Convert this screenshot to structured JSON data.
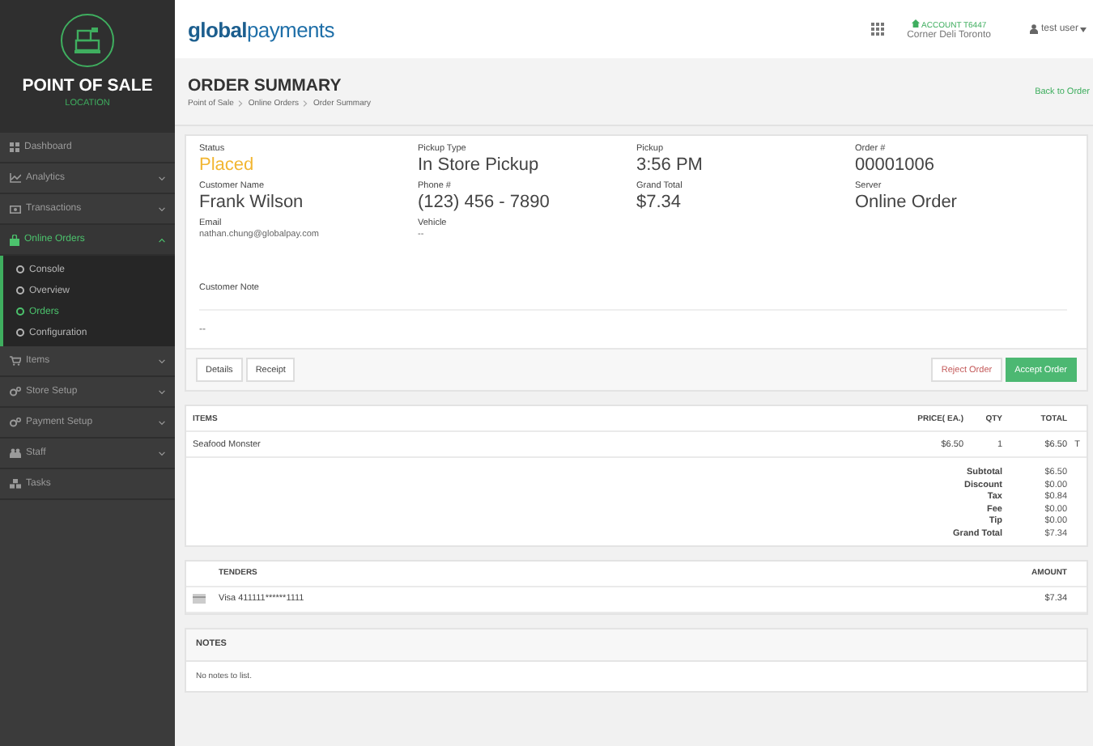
{
  "sidebar": {
    "title": "POINT OF SALE",
    "subtitle": "LOCATION",
    "items": [
      {
        "label": "Dashboard",
        "has_children": false,
        "selected": false
      },
      {
        "label": "Analytics",
        "has_children": true,
        "expanded": false,
        "selected": false
      },
      {
        "label": "Transactions",
        "has_children": true,
        "expanded": false,
        "selected": false
      },
      {
        "label": "Online Orders",
        "has_children": true,
        "expanded": true,
        "selected": true,
        "children": [
          {
            "label": "Console",
            "selected": false
          },
          {
            "label": "Overview",
            "selected": false
          },
          {
            "label": "Orders",
            "selected": true
          },
          {
            "label": "Configuration",
            "selected": false
          }
        ]
      },
      {
        "label": "Items",
        "has_children": true,
        "expanded": false,
        "selected": false
      },
      {
        "label": "Store Setup",
        "has_children": true,
        "expanded": false,
        "selected": false
      },
      {
        "label": "Payment Setup",
        "has_children": true,
        "expanded": false,
        "selected": false
      },
      {
        "label": "Staff",
        "has_children": true,
        "expanded": false,
        "selected": false
      },
      {
        "label": "Tasks",
        "has_children": false,
        "selected": false
      }
    ]
  },
  "topbar": {
    "logo_bold": "global",
    "logo_light": "payments",
    "account": "ACCOUNT T6447",
    "store": "Corner Deli Toronto",
    "user": "test user"
  },
  "header": {
    "title": "ORDER SUMMARY",
    "breadcrumb": [
      "Point of Sale",
      "Online Orders",
      "Order Summary"
    ],
    "back_link": "Back to Order"
  },
  "order": {
    "fields": [
      {
        "label": "Status",
        "value": "Placed",
        "kind": "status"
      },
      {
        "label": "Pickup Type",
        "value": "In Store Pickup",
        "kind": "large"
      },
      {
        "label": "Pickup",
        "value": "3:56 PM",
        "kind": "large"
      },
      {
        "label": "Order #",
        "value": "00001006",
        "kind": "large"
      },
      {
        "label": "Customer Name",
        "value": "Frank Wilson",
        "kind": "large"
      },
      {
        "label": "Phone #",
        "value": "(123) 456 - 7890",
        "kind": "large"
      },
      {
        "label": "Grand Total",
        "value": "$7.34",
        "kind": "large"
      },
      {
        "label": "Server",
        "value": "Online Order",
        "kind": "large"
      },
      {
        "label": "Email",
        "value": "nathan.chung@globalpay.com",
        "kind": "small"
      },
      {
        "label": "Vehicle",
        "value": "--",
        "kind": "small"
      }
    ],
    "note_label": "Customer Note",
    "note": "--",
    "buttons": [
      {
        "label": "Details",
        "kind": "plain"
      },
      {
        "label": "Receipt",
        "kind": "plain"
      },
      {
        "label": "Reject Order",
        "kind": "reject"
      },
      {
        "label": "Accept Order",
        "kind": "accept"
      }
    ]
  },
  "items_table": {
    "columns": [
      "ITEMS",
      "PRICE( EA.)",
      "QTY",
      "TOTAL"
    ],
    "rows": [
      {
        "name": "Seafood Monster",
        "price": "$6.50",
        "qty": "1",
        "total": "$6.50",
        "column_5": "T"
      }
    ],
    "totals": [
      {
        "label": "Subtotal",
        "value": "$6.50"
      },
      {
        "label": "Discount",
        "value": "$0.00"
      },
      {
        "label": "Tax",
        "value": "$0.84"
      },
      {
        "label": "Fee",
        "value": "$0.00"
      },
      {
        "label": "Tip",
        "value": "$0.00"
      },
      {
        "label": "Grand Total",
        "value": "$7.34"
      }
    ]
  },
  "tenders": {
    "columns": [
      "TENDERS",
      "AMOUNT"
    ],
    "rows": [
      {
        "name": "Visa 411111******1111",
        "amount": "$7.34"
      }
    ]
  },
  "notes": {
    "title": "NOTES",
    "empty": "No notes to list."
  }
}
